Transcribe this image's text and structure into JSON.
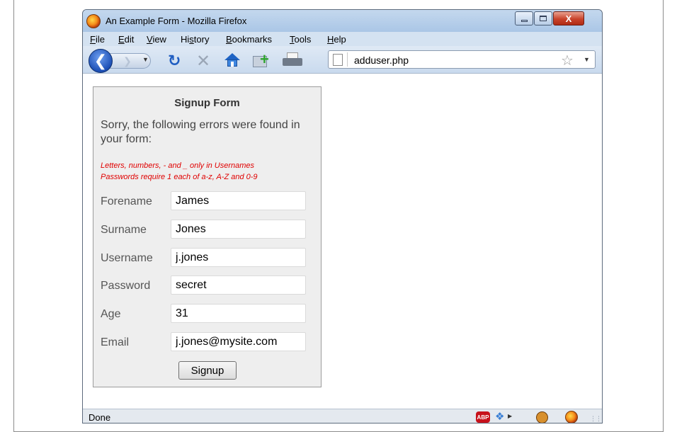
{
  "window": {
    "title": "An Example Form - Mozilla Firefox",
    "controls": {
      "minimize": "minimize",
      "maximize": "maximize",
      "close": "X"
    }
  },
  "menu": [
    {
      "underline": "F",
      "rest": "ile"
    },
    {
      "underline": "E",
      "rest": "dit"
    },
    {
      "underline": "V",
      "rest": "iew"
    },
    {
      "pre": "Hi",
      "underline": "s",
      "rest": "tory"
    },
    {
      "underline": "B",
      "rest": "ookmarks"
    },
    {
      "underline": "T",
      "rest": "ools"
    },
    {
      "underline": "H",
      "rest": "elp"
    }
  ],
  "toolbar": {
    "icons": [
      "back-arrow-icon",
      "forward-arrow-icon",
      "reload-icon",
      "stop-icon",
      "home-icon",
      "new-bookmark-icon",
      "print-icon"
    ],
    "address": "adduser.php"
  },
  "form": {
    "title": "Signup Form",
    "error_intro": "Sorry, the following errors were found in your form:",
    "errors": [
      "Letters, numbers, - and _ only in Usernames",
      "Passwords require 1 each of a-z, A-Z and 0-9"
    ],
    "fields": [
      {
        "label": "Forename",
        "value": "James"
      },
      {
        "label": "Surname",
        "value": "Jones"
      },
      {
        "label": "Username",
        "value": "j.jones"
      },
      {
        "label": "Password",
        "value": "secret"
      },
      {
        "label": "Age",
        "value": "31"
      },
      {
        "label": "Email",
        "value": "j.jones@mysite.com"
      }
    ],
    "submit_label": "Signup"
  },
  "status": {
    "text": "Done",
    "adblock_label": "ABP"
  },
  "colors": {
    "error_text": "#e00000",
    "form_background": "#eeeeee",
    "window_chrome": "#bcd3ea"
  }
}
